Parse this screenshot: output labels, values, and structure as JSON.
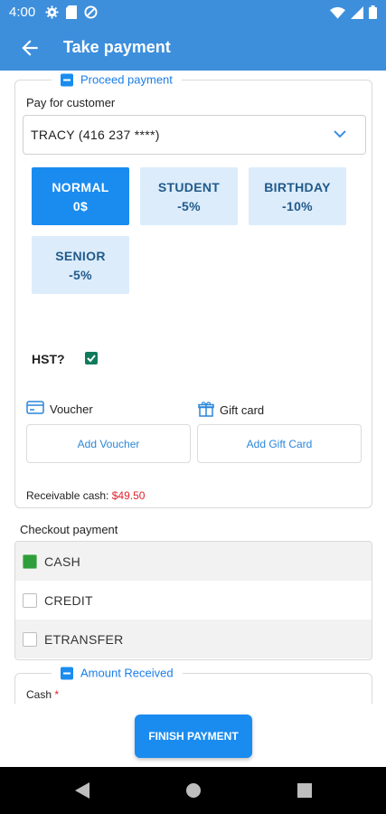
{
  "status_bar": {
    "time": "4:00",
    "left_icons": [
      "settings-icon",
      "sd-card-icon",
      "blocked-icon"
    ],
    "right_icons": [
      "wifi-icon",
      "signal-icon",
      "battery-icon"
    ]
  },
  "app_bar": {
    "title": "Take payment",
    "back_icon": "arrow-back-icon"
  },
  "proceed_section": {
    "legend": "Proceed payment",
    "pay_for_label": "Pay for customer",
    "customer_value": "TRACY (416 237 ****)",
    "discounts": [
      {
        "label": "NORMAL",
        "value": "0$",
        "selected": true
      },
      {
        "label": "STUDENT",
        "value": "-5%",
        "selected": false
      },
      {
        "label": "BIRTHDAY",
        "value": "-10%",
        "selected": false
      },
      {
        "label": "SENIOR",
        "value": "-5%",
        "selected": false
      }
    ],
    "hst_label": "HST?",
    "hst_checked": true,
    "voucher_label": "Voucher",
    "gift_card_label": "Gift card",
    "add_voucher": "Add Voucher",
    "add_gift_card": "Add Gift Card",
    "receivable_label": "Receivable cash:",
    "receivable_amount": "$49.50"
  },
  "checkout": {
    "title": "Checkout payment",
    "options": [
      {
        "label": "CASH",
        "checked": true
      },
      {
        "label": "CREDIT",
        "checked": false
      },
      {
        "label": "ETRANSFER",
        "checked": false
      }
    ]
  },
  "amount_section": {
    "legend": "Amount Received",
    "cash_label": "Cash",
    "required_mark": "*"
  },
  "footer": {
    "finish_button": "FINISH PAYMENT"
  },
  "colors": {
    "primary": "#3d8fdc",
    "button_blue": "#1a8cf0",
    "discount_inactive_bg": "#dcecfb",
    "hst_check": "#0f7b5c",
    "cash_check": "#2e9e3a",
    "amount_red": "#e0232e"
  }
}
